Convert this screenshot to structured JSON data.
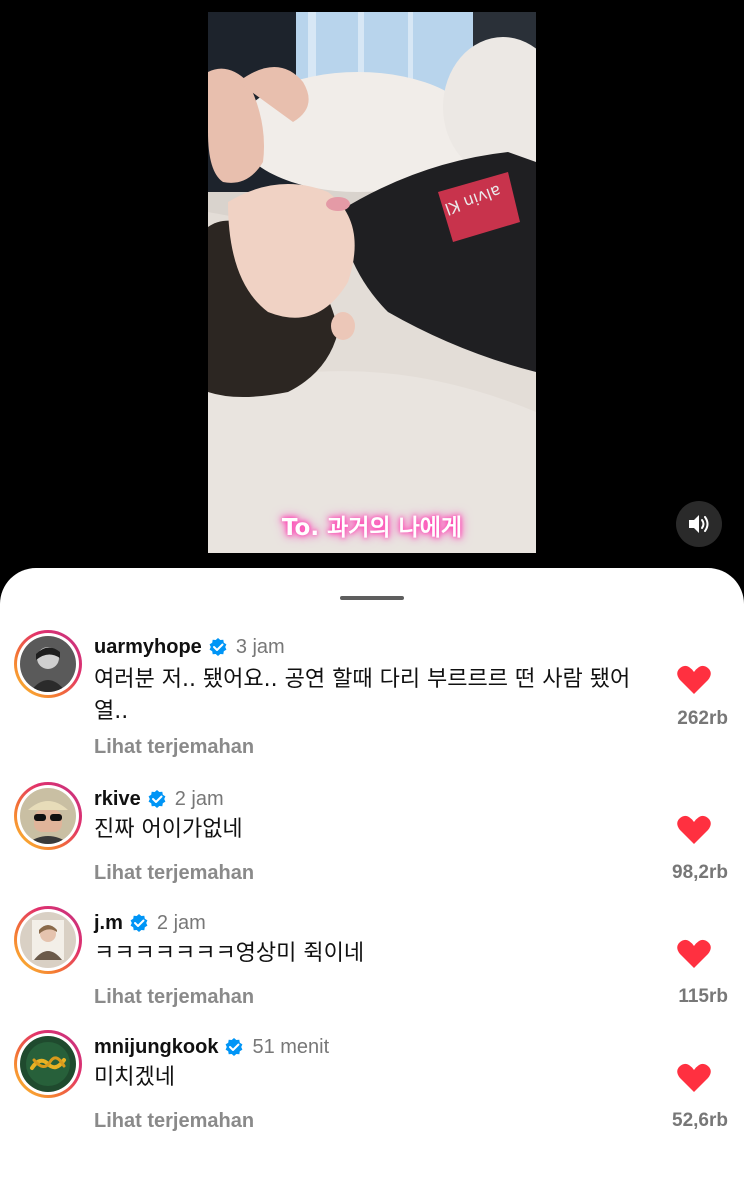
{
  "video": {
    "caption": "To. 과거의 나에게",
    "sound_icon": "speaker-on-icon",
    "shirt_text": "alvin Kl"
  },
  "comments": [
    {
      "username": "uarmyhope",
      "verified": true,
      "time": "3 jam",
      "text": "여러분 저.. 됐어요.. 공연 할때 다리 부르르르 떤 사람 됐어열..",
      "translate_label": "Lihat terjemahan",
      "likes": "262rb",
      "liked": true
    },
    {
      "username": "rkive",
      "verified": true,
      "time": "2 jam",
      "text": "진짜 어이가없네",
      "translate_label": "Lihat terjemahan",
      "likes": "98,2rb",
      "liked": true
    },
    {
      "username": "j.m",
      "verified": true,
      "time": "2 jam",
      "text": "ㅋㅋㅋㅋㅋㅋㅋ영상미 쥑이네",
      "translate_label": "Lihat terjemahan",
      "likes": "115rb",
      "liked": true
    },
    {
      "username": "mnijungkook",
      "verified": true,
      "time": "51 menit",
      "text": "미치겠네",
      "translate_label": "Lihat terjemahan",
      "likes": "52,6rb",
      "liked": true
    }
  ],
  "colors": {
    "like_red": "#ff3040",
    "verified_blue": "#0095f6",
    "muted_text": "#8a8a8a"
  }
}
